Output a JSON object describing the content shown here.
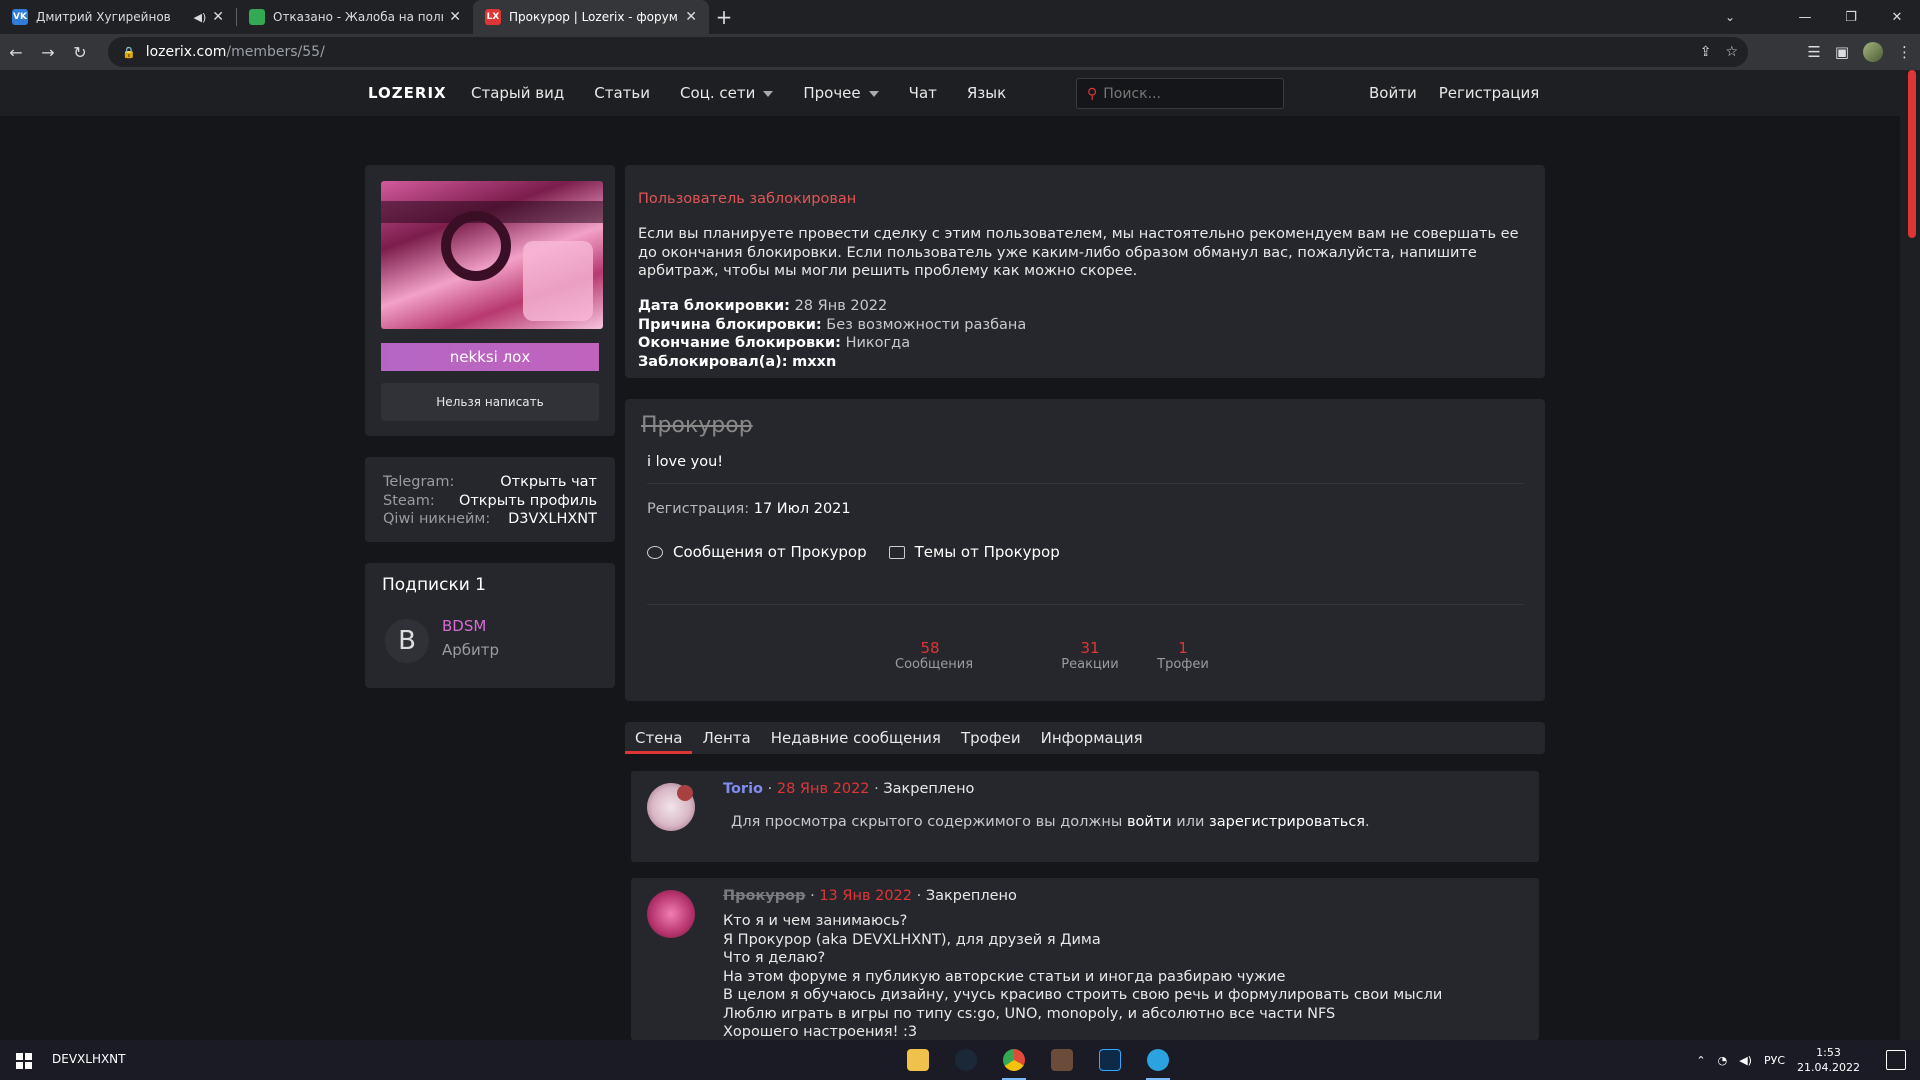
{
  "browser": {
    "tabs": [
      {
        "title": "Дмитрий Хугирейнов",
        "favicon": "vk-icon",
        "favicon_color": "#2f7cd9",
        "favicon_text": "VK"
      },
      {
        "title": "Отказано - Жалоба на пользова",
        "favicon": "chart-icon",
        "favicon_color": "#34a853",
        "favicon_text": ""
      },
      {
        "title": "Прокурор | Lozerix - форум о со",
        "favicon": "lx-icon",
        "favicon_color": "#e03535",
        "favicon_text": "LX"
      }
    ],
    "url_host": "lozerix.com",
    "url_path": "/members/55/"
  },
  "site": {
    "logo": "LOZERIX",
    "nav": [
      "Старый вид",
      "Статьи",
      "Соц. сети",
      "Прочее",
      "Чат",
      "Язык"
    ],
    "search_placeholder": "Поиск...",
    "login": "Войти",
    "register": "Регистрация"
  },
  "sidebar": {
    "username_button": "nekksi лох",
    "cant_write": "Нельзя написать",
    "contacts": [
      {
        "key": "Telegram:",
        "value": "Открыть чат"
      },
      {
        "key": "Steam:",
        "value": "Открыть профиль"
      },
      {
        "key": "Qiwi никнейм:",
        "value": "D3VXLHXNT"
      }
    ],
    "subs_title": "Подписки 1",
    "sub": {
      "letter": "B",
      "name": "BDSM",
      "role": "Арбитр"
    }
  },
  "ban": {
    "title": "Пользователь заблокирован",
    "message": "Если вы планируете провести сделку с этим пользователем, мы настоятельно рекомендуем вам не совершать ее до окончания блокировки. Если пользователь уже каким-либо образом обманул вас, пожалуйста, напишите арбитраж, чтобы мы могли решить проблему как можно скорее.",
    "date_label": "Дата блокировки:",
    "date_value": "28 Янв 2022",
    "reason_label": "Причина блокировки:",
    "reason_value": "Без возможности разбана",
    "end_label": "Окончание блокировки:",
    "end_value": "Никогда",
    "by_label": "Заблокировал(а):",
    "by_value": "mxxn"
  },
  "profile": {
    "name": "Прокурор",
    "status": "i love you!",
    "reg_label": "Регистрация:",
    "reg_date": "17 Июл 2021",
    "messages_link": "Сообщения от Прокурор",
    "threads_link": "Темы от Прокурор",
    "stats": [
      {
        "value": "58",
        "label": "Сообщения"
      },
      {
        "value": "31",
        "label": "Реакции"
      },
      {
        "value": "1",
        "label": "Трофеи"
      }
    ]
  },
  "tabs": [
    "Стена",
    "Лента",
    "Недавние сообщения",
    "Трофеи",
    "Информация"
  ],
  "posts": [
    {
      "author": "Torio",
      "date": "28 Янв 2022",
      "pinned": "Закреплено",
      "body_pre": "Для просмотра скрытого содержимого вы должны ",
      "login_link": "войти",
      "body_mid": " или ",
      "register_link": "зарегистрироваться",
      "body_post": "."
    },
    {
      "author": "Прокурор",
      "date": "13 Янв 2022",
      "pinned": "Закреплено",
      "lines": [
        "Кто я и чем занимаюсь?",
        "Я Прокурор (aka DEVXLHXNT), для друзей я Дима",
        "Что я делаю?",
        "На этом форуме я публикую авторские статьи и иногда разбираю чужие",
        "В целом я обучаюсь дизайну, учусь красиво строить свою речь и формулировать свои мысли",
        "Люблю играть в игры по типу cs:go, UNO, monopoly, и абсолютно все части NFS",
        "Хорошего настроения! :3"
      ]
    }
  ],
  "taskbar": {
    "user": "DEVXLHXNT",
    "lang": "РУС",
    "time": "1:53",
    "date": "21.04.2022",
    "apps": [
      {
        "name": "explorer-icon",
        "color": "#f0c24b"
      },
      {
        "name": "steam-icon",
        "color": "#1b2838"
      },
      {
        "name": "chrome-icon",
        "color": "#e04a3a"
      },
      {
        "name": "game-icon",
        "color": "#6b4b3a"
      },
      {
        "name": "photoshop-icon",
        "color": "#0e2a47"
      },
      {
        "name": "telegram-icon",
        "color": "#2aa3e0"
      }
    ]
  }
}
